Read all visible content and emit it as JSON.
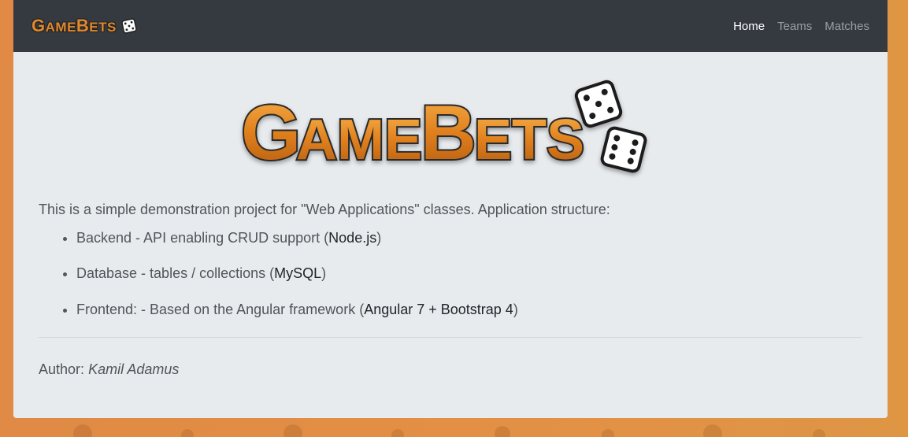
{
  "navbar": {
    "brand_first": "G",
    "brand_rest_1": "AME",
    "brand_second": "B",
    "brand_rest_2": "ETS",
    "brand_icon": "dice-icon",
    "links": [
      {
        "label": "Home",
        "active": true
      },
      {
        "label": "Teams",
        "active": false
      },
      {
        "label": "Matches",
        "active": false
      }
    ]
  },
  "logo": {
    "text": "GameBets",
    "icon": "dice-icon"
  },
  "main": {
    "intro": "This is a simple demonstration project for \"Web Applications\" classes. Application structure:",
    "items": [
      {
        "prefix": "Backend - API enabling CRUD support (",
        "tech": "Node.js",
        "suffix": ")"
      },
      {
        "prefix": "Database - tables / collections (",
        "tech": "MySQL",
        "suffix": ")"
      },
      {
        "prefix": "Frontend: - Based on the Angular framework (",
        "tech": "Angular 7 + Bootstrap 4",
        "suffix": ")"
      }
    ],
    "author_label": "Author:",
    "author_name": "Kamil Adamus"
  },
  "colors": {
    "accent": "#e0882c",
    "navbar_bg": "#343a40",
    "content_bg": "#e8ebee",
    "page_bg": "#e38f45"
  }
}
